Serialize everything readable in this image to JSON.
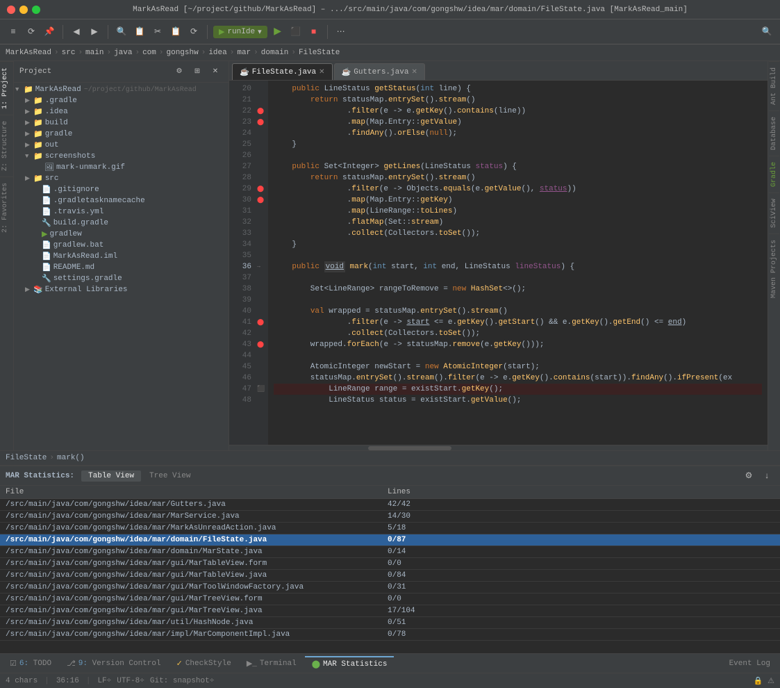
{
  "titlebar": {
    "text": "MarkAsRead [~/project/github/MarkAsRead] – .../src/main/java/com/gongshw/idea/mar/domain/FileState.java [MarkAsRead_main]"
  },
  "breadcrumb": {
    "items": [
      "MarkAsRead",
      "src",
      "main",
      "java",
      "com",
      "gongshw",
      "idea",
      "mar",
      "domain",
      "FileState"
    ]
  },
  "tabs": [
    {
      "label": "FileState.java",
      "icon": "java",
      "active": true
    },
    {
      "label": "Gutters.java",
      "icon": "java",
      "active": false
    }
  ],
  "location": {
    "file": "FileState",
    "method": "mark()"
  },
  "code": {
    "lines": [
      {
        "num": "20",
        "content": "    public LineStatus getStatus(int line) {"
      },
      {
        "num": "21",
        "content": "        return statusMap.entrySet().stream()"
      },
      {
        "num": "22",
        "content": "                .filter(e -> e.getKey().contains(line))"
      },
      {
        "num": "23",
        "content": "                .map(Map.Entry::getValue)"
      },
      {
        "num": "24",
        "content": "                .findAny().orElse(null);"
      },
      {
        "num": "25",
        "content": "    }"
      },
      {
        "num": "26",
        "content": ""
      },
      {
        "num": "27",
        "content": "    public Set<Integer> getLines(LineStatus status) {"
      },
      {
        "num": "28",
        "content": "        return statusMap.entrySet().stream()"
      },
      {
        "num": "29",
        "content": "                .filter(e -> Objects.equals(e.getValue(), status))"
      },
      {
        "num": "30",
        "content": "                .map(Map.Entry::getKey)"
      },
      {
        "num": "31",
        "content": "                .map(LineRange::toLines)"
      },
      {
        "num": "32",
        "content": "                .flatMap(Set::stream)"
      },
      {
        "num": "33",
        "content": "                .collect(Collectors.toSet());"
      },
      {
        "num": "34",
        "content": "    }"
      },
      {
        "num": "35",
        "content": ""
      },
      {
        "num": "36",
        "content": "    public void mark(int start, int end, LineStatus lineStatus) {"
      },
      {
        "num": "37",
        "content": ""
      },
      {
        "num": "38",
        "content": "        Set<LineRange> rangeToRemove = new HashSet<>();"
      },
      {
        "num": "39",
        "content": ""
      },
      {
        "num": "40",
        "content": "        val wrapped = statusMap.entrySet().stream()"
      },
      {
        "num": "41",
        "content": "                .filter(e -> start <= e.getKey().getStart() && e.getKey().getEnd() <= end)"
      },
      {
        "num": "42",
        "content": "                .collect(Collectors.toSet());"
      },
      {
        "num": "43",
        "content": "        wrapped.forEach(e -> statusMap.remove(e.getKey()));"
      },
      {
        "num": "44",
        "content": ""
      },
      {
        "num": "45",
        "content": "        AtomicInteger newStart = new AtomicInteger(start);"
      },
      {
        "num": "46",
        "content": "        statusMap.entrySet().stream().filter(e -> e.getKey().contains(start)).findAny().ifPresent(ex"
      },
      {
        "num": "47",
        "content": "            LineRange range = existStart.getKey();"
      },
      {
        "num": "48",
        "content": "            LineStatus status = existStart.getValue();"
      }
    ]
  },
  "sidebar": {
    "title": "Project",
    "tree": [
      {
        "indent": 0,
        "icon": "📁",
        "label": "MarkAsRead",
        "extra": "~/project/github/MarkAsRead",
        "expanded": true
      },
      {
        "indent": 1,
        "icon": "📁",
        "label": ".gradle",
        "expanded": false
      },
      {
        "indent": 1,
        "icon": "📁",
        "label": ".idea",
        "expanded": false
      },
      {
        "indent": 1,
        "icon": "📁",
        "label": "build",
        "expanded": false
      },
      {
        "indent": 1,
        "icon": "📁",
        "label": "gradle",
        "expanded": false
      },
      {
        "indent": 1,
        "icon": "📁",
        "label": "out",
        "expanded": false
      },
      {
        "indent": 1,
        "icon": "📁",
        "label": "screenshots",
        "expanded": true
      },
      {
        "indent": 2,
        "icon": "🖼",
        "label": "mark-unmark.gif"
      },
      {
        "indent": 1,
        "icon": "📁",
        "label": "src",
        "expanded": false
      },
      {
        "indent": 2,
        "icon": "📄",
        "label": ".gitignore"
      },
      {
        "indent": 2,
        "icon": "📄",
        "label": ".gradletasknamecache"
      },
      {
        "indent": 2,
        "icon": "📄",
        "label": ".travis.yml"
      },
      {
        "indent": 2,
        "icon": "🔧",
        "label": "build.gradle"
      },
      {
        "indent": 2,
        "icon": "🔧",
        "label": "gradlew"
      },
      {
        "indent": 2,
        "icon": "📄",
        "label": "gradlew.bat"
      },
      {
        "indent": 2,
        "icon": "📄",
        "label": "MarkAsRead.iml"
      },
      {
        "indent": 2,
        "icon": "📄",
        "label": "README.md"
      },
      {
        "indent": 2,
        "icon": "🔧",
        "label": "settings.gradle"
      },
      {
        "indent": 1,
        "icon": "📁",
        "label": "External Libraries",
        "expanded": false
      }
    ]
  },
  "bottom_tabs": {
    "label": "MAR Statistics:",
    "views": [
      "Table View",
      "Tree View"
    ]
  },
  "mar_table": {
    "headers": [
      "File",
      "Lines"
    ],
    "rows": [
      {
        "file": "/src/main/java/com/gongshw/idea/mar/Gutters.java",
        "lines": "42/42",
        "selected": false
      },
      {
        "file": "/src/main/java/com/gongshw/idea/mar/MarService.java",
        "lines": "14/30",
        "selected": false
      },
      {
        "file": "/src/main/java/com/gongshw/idea/mar/MarkAsUnreadAction.java",
        "lines": "5/18",
        "selected": false
      },
      {
        "file": "/src/main/java/com/gongshw/idea/mar/domain/FileState.java",
        "lines": "0/87",
        "selected": true
      },
      {
        "file": "/src/main/java/com/gongshw/idea/mar/domain/MarState.java",
        "lines": "0/14",
        "selected": false
      },
      {
        "file": "/src/main/java/com/gongshw/idea/mar/gui/MarTableView.form",
        "lines": "0/0",
        "selected": false
      },
      {
        "file": "/src/main/java/com/gongshw/idea/mar/gui/MarTableView.java",
        "lines": "0/84",
        "selected": false
      },
      {
        "file": "/src/main/java/com/gongshw/idea/mar/gui/MarToolWindowFactory.java",
        "lines": "0/31",
        "selected": false
      },
      {
        "file": "/src/main/java/com/gongshw/idea/mar/gui/MarTreeView.form",
        "lines": "0/0",
        "selected": false
      },
      {
        "file": "/src/main/java/com/gongshw/idea/mar/gui/MarTreeView.java",
        "lines": "17/104",
        "selected": false
      },
      {
        "file": "/src/main/java/com/gongshw/idea/mar/util/HashNode.java",
        "lines": "0/51",
        "selected": false
      },
      {
        "file": "/src/main/java/com/gongshw/idea/mar/impl/MarComponentImpl.java",
        "lines": "0/78",
        "selected": false
      }
    ]
  },
  "tool_tabs": [
    {
      "num": "6",
      "label": "TODO",
      "active": false
    },
    {
      "num": "9",
      "label": "Version Control",
      "active": false
    },
    {
      "label": "CheckStyle",
      "active": false,
      "num": ""
    },
    {
      "label": "Terminal",
      "active": false,
      "num": ""
    },
    {
      "label": "MAR Statistics",
      "active": true,
      "num": ""
    }
  ],
  "status_bar": {
    "chars": "4 chars",
    "position": "36:16",
    "lf": "LF÷",
    "encoding": "UTF-8÷",
    "vcs": "Git: snapshot÷",
    "event_log": "Event Log"
  },
  "right_panels": [
    "Ant Build",
    "Database",
    "Gradle",
    "SciView",
    "m Maven Projects"
  ],
  "left_vtabs": [
    "1: Project",
    "2: Structure",
    "2: Favorites"
  ]
}
